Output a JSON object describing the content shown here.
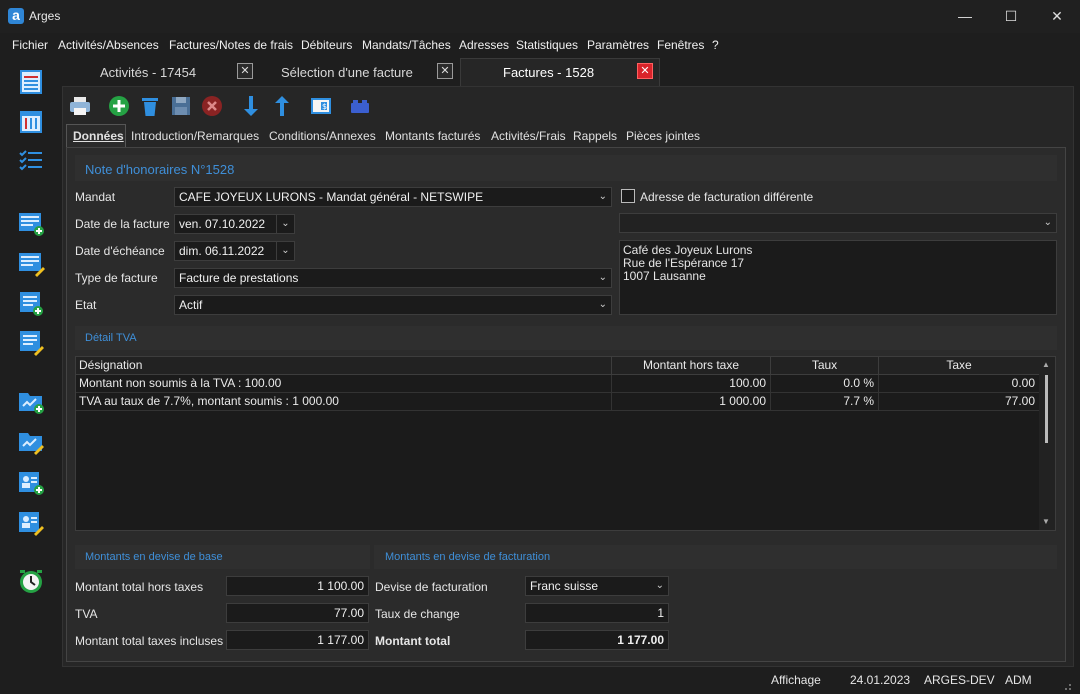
{
  "app": {
    "title": "Arges",
    "logo_letter": "a"
  },
  "window_controls": {
    "minimize": "—",
    "maximize": "☐",
    "close": "✕"
  },
  "menu": [
    "Fichier",
    "Activités/Absences",
    "Factures/Notes de frais",
    "Débiteurs",
    "Mandats/Tâches",
    "Adresses",
    "Statistiques",
    "Paramètres",
    "Fenêtres",
    "?"
  ],
  "doc_tabs": [
    {
      "label": "Activités - 17454",
      "close": "✕"
    },
    {
      "label": "Sélection d'une facture",
      "close": "✕"
    },
    {
      "label": "Factures - 1528",
      "close": "✕"
    }
  ],
  "subtabs": [
    "Données",
    "Introduction/Remarques",
    "Conditions/Annexes",
    "Montants facturés",
    "Activités/Frais",
    "Rappels",
    "Pièces jointes"
  ],
  "header": {
    "title": "Note d'honoraires N°1528"
  },
  "form": {
    "mandat_label": "Mandat",
    "mandat_value": "CAFE JOYEUX LURONS - Mandat général - NETSWIPE",
    "date_facture_label": "Date de la facture",
    "date_facture_value": "ven. 07.10.2022",
    "date_echeance_label": "Date d'échéance",
    "date_echeance_value": "dim. 06.11.2022",
    "type_label": "Type de facture",
    "type_value": "Facture de prestations",
    "etat_label": "Etat",
    "etat_value": "Actif",
    "adresse_diff_label": "Adresse de facturation différente",
    "address": [
      "Café des Joyeux Lurons",
      "Rue de l'Espérance 17",
      "1007 Lausanne"
    ]
  },
  "tva": {
    "title": "Détail TVA",
    "columns": [
      "Désignation",
      "Montant hors taxe",
      "Taux",
      "Taxe"
    ],
    "rows": [
      [
        "Montant non soumis à la TVA : 100.00",
        "100.00",
        "0.0 %",
        "0.00"
      ],
      [
        "TVA au taux de 7.7%, montant soumis : 1 000.00",
        "1 000.00",
        "7.7 %",
        "77.00"
      ]
    ]
  },
  "base": {
    "title": "Montants en devise de base",
    "total_ht_label": "Montant total hors taxes",
    "total_ht_value": "1 100.00",
    "tva_label": "TVA",
    "tva_value": "77.00",
    "total_ttc_label": "Montant total taxes incluses",
    "total_ttc_value": "1 177.00"
  },
  "facturation": {
    "title": "Montants en devise de facturation",
    "devise_label": "Devise de facturation",
    "devise_value": "Franc suisse",
    "taux_label": "Taux de change",
    "taux_value": "1",
    "total_label": "Montant total",
    "total_value": "1 177.00"
  },
  "status": {
    "affichage": "Affichage",
    "date": "24.01.2023",
    "env": "ARGES-DEV",
    "user": "ADM"
  },
  "colors": {
    "accent": "#3f8fd8",
    "close_red": "#d9232a",
    "background": "#1e1e1e"
  }
}
